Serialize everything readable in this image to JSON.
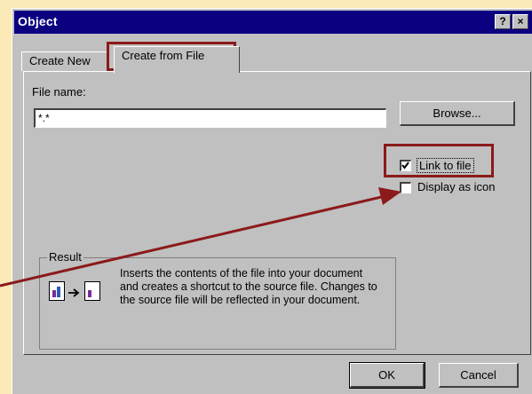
{
  "window": {
    "title": "Object"
  },
  "title_buttons": {
    "help": "?",
    "close": "×"
  },
  "tabs": {
    "create_new": "Create New",
    "create_from_file": "Create from File"
  },
  "file_name": {
    "label": "File name:",
    "value": "*.*"
  },
  "browse_button": "Browse...",
  "link_to_file": {
    "label": "Link to file",
    "checked": true
  },
  "display_as_icon": {
    "label": "Display as icon",
    "checked": false
  },
  "result": {
    "title": "Result",
    "text": "Inserts the contents of the file into your document and creates a shortcut to the source file. Changes to the source file will be reflected in your document."
  },
  "ok_button": "OK",
  "cancel_button": "Cancel",
  "colors": {
    "annotation": "#8b1a1a",
    "titlebar": "#0b0080",
    "background": "#fbe9b7"
  }
}
